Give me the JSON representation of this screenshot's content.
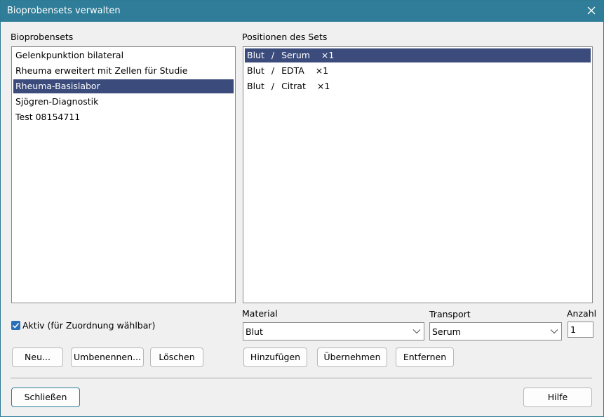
{
  "window": {
    "title": "Bioprobensets verwalten"
  },
  "sets": {
    "label": "Bioprobensets",
    "items": [
      {
        "text": "Gelenkpunktion bilateral",
        "selected": false
      },
      {
        "text": "Rheuma erweitert mit Zellen für Studie",
        "selected": false
      },
      {
        "text": "Rheuma-Basislabor",
        "selected": true
      },
      {
        "text": "Sjögren-Diagnostik",
        "selected": false
      },
      {
        "text": "Test 08154711",
        "selected": false
      }
    ]
  },
  "positions": {
    "label": "Positionen des Sets",
    "items": [
      {
        "material": "Blut",
        "sep": "/",
        "transport": "Serum",
        "count": "×1",
        "selected": true
      },
      {
        "material": "Blut",
        "sep": "/",
        "transport": "EDTA",
        "count": "×1",
        "selected": false
      },
      {
        "material": "Blut",
        "sep": "/",
        "transport": "Citrat",
        "count": "×1",
        "selected": false
      }
    ]
  },
  "active_checkbox": {
    "label": "Aktiv (für Zuordnung wählbar)",
    "checked": true
  },
  "material": {
    "label": "Material",
    "value": "Blut"
  },
  "transport": {
    "label": "Transport",
    "value": "Serum"
  },
  "anzahl": {
    "label": "Anzahl",
    "value": "1"
  },
  "buttons": {
    "new": "Neu...",
    "rename": "Umbenennen...",
    "delete": "Löschen",
    "add": "Hinzufügen",
    "apply": "Übernehmen",
    "remove": "Entfernen",
    "close": "Schließen",
    "help": "Hilfe"
  },
  "colors": {
    "titlebar": "#2f7d98",
    "selection": "#3b4b7c",
    "checkbox": "#2a6fb8"
  }
}
